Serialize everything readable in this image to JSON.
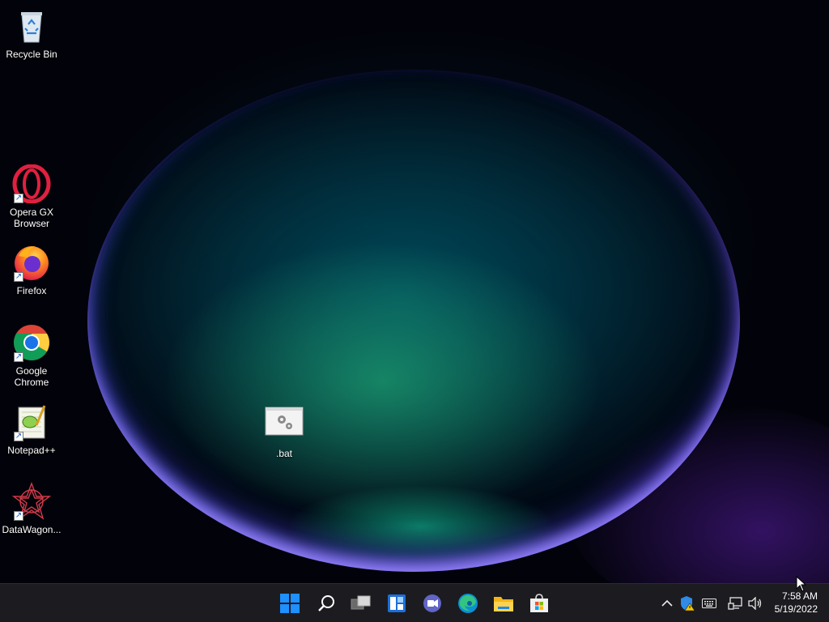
{
  "desktop": {
    "icons": [
      {
        "label": "Recycle Bin",
        "icon": "recycle-bin-icon"
      },
      {
        "label": "Opera GX Browser",
        "icon": "opera-gx-icon"
      },
      {
        "label": "Firefox",
        "icon": "firefox-icon"
      },
      {
        "label": "Google Chrome",
        "icon": "chrome-icon"
      },
      {
        "label": "Notepad++",
        "icon": "notepad-plus-plus-icon"
      },
      {
        "label": "DataWagon...",
        "icon": "datawagon-icon"
      },
      {
        "label": ".bat",
        "icon": "batch-file-icon"
      }
    ]
  },
  "taskbar": {
    "apps": [
      "start-icon",
      "search-icon",
      "task-view-icon",
      "widgets-icon",
      "teams-chat-icon",
      "edge-icon",
      "file-explorer-icon",
      "microsoft-store-icon"
    ],
    "tray": [
      "chevron-up-icon",
      "windows-security-icon",
      "keyboard-icon",
      "network-icon",
      "volume-icon"
    ],
    "clock": {
      "time": "7:58 AM",
      "date": "5/19/2022"
    }
  },
  "colors": {
    "taskbar_bg": "#1c1c20",
    "accent_blue": "#1e90ff",
    "wallpaper_bg": "#02030a"
  }
}
